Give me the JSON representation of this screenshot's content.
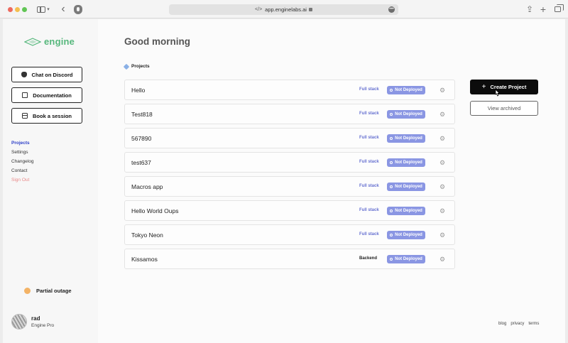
{
  "browser": {
    "url": "app.enginelabs.ai"
  },
  "sidebar": {
    "logo_text": "engine",
    "buttons": [
      {
        "label": "Chat on Discord",
        "icon": "discord-icon"
      },
      {
        "label": "Documentation",
        "icon": "document-icon"
      },
      {
        "label": "Book a session",
        "icon": "calendar-icon"
      }
    ],
    "nav": [
      {
        "label": "Projects",
        "active": true
      },
      {
        "label": "Settings"
      },
      {
        "label": "Changelog"
      },
      {
        "label": "Contact"
      },
      {
        "label": "Sign Out"
      }
    ],
    "status": {
      "label": "Partial outage",
      "color": "#f3b366"
    },
    "user": {
      "name": "rad",
      "plan": "Engine Pro"
    }
  },
  "main": {
    "greeting": "Good morning",
    "projects_heading": "Projects",
    "projects": [
      {
        "name": "Hello",
        "stack": "Full stack",
        "status": "Not Deployed"
      },
      {
        "name": "Test818",
        "stack": "Full stack",
        "status": "Not Deployed"
      },
      {
        "name": "567890",
        "stack": "Full stack",
        "status": "Not Deployed"
      },
      {
        "name": "test637",
        "stack": "Full stack",
        "status": "Not Deployed"
      },
      {
        "name": "Macros app",
        "stack": "Full stack",
        "status": "Not Deployed"
      },
      {
        "name": "Hello World Oups",
        "stack": "Full stack",
        "status": "Not Deployed"
      },
      {
        "name": "Tokyo Neon",
        "stack": "Full stack",
        "status": "Not Deployed"
      },
      {
        "name": "Kissamos",
        "stack": "Backend",
        "status": "Not Deployed"
      }
    ],
    "create_label": "Create Project",
    "archived_label": "View archived"
  },
  "footer": {
    "links": [
      "blog",
      "privacy",
      "terms"
    ]
  },
  "colors": {
    "accent": "#2d3fc8",
    "brand": "#56b77c",
    "badge": "#8a96e3",
    "signout": "#e98888"
  }
}
